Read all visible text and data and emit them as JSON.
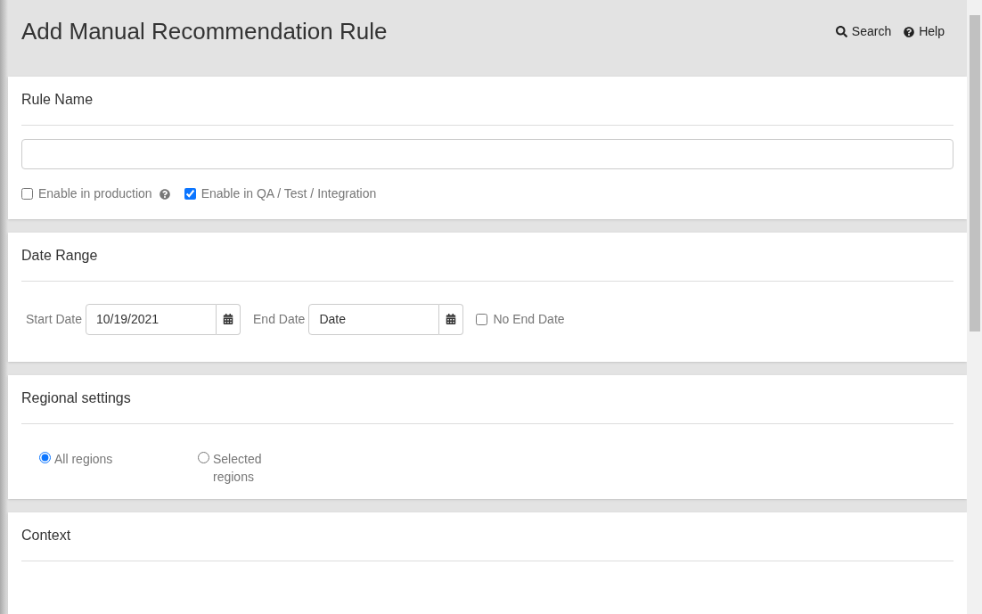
{
  "header": {
    "title": "Add Manual Recommendation Rule",
    "links": [
      {
        "kind": "search",
        "label": "Search"
      },
      {
        "kind": "help",
        "label": "Help"
      }
    ]
  },
  "rule_name": {
    "title": "Rule Name",
    "options": [
      {
        "label": "Enable in production",
        "checked": false,
        "help": true
      },
      {
        "label": "Enable in QA / Test / Integration",
        "checked": true,
        "help": false
      }
    ]
  },
  "date_range": {
    "title": "Date Range",
    "start": {
      "label": "Start Date",
      "value": "10/19/2021"
    },
    "end": {
      "label": "End Date",
      "value": "Date"
    },
    "no_end_date": {
      "label": "No End Date",
      "checked": false
    }
  },
  "regional": {
    "title": "Regional settings",
    "options": [
      {
        "label": "All regions",
        "selected": true
      },
      {
        "label": "Selected regions",
        "selected": false
      }
    ]
  },
  "context": {
    "title": "Context"
  }
}
